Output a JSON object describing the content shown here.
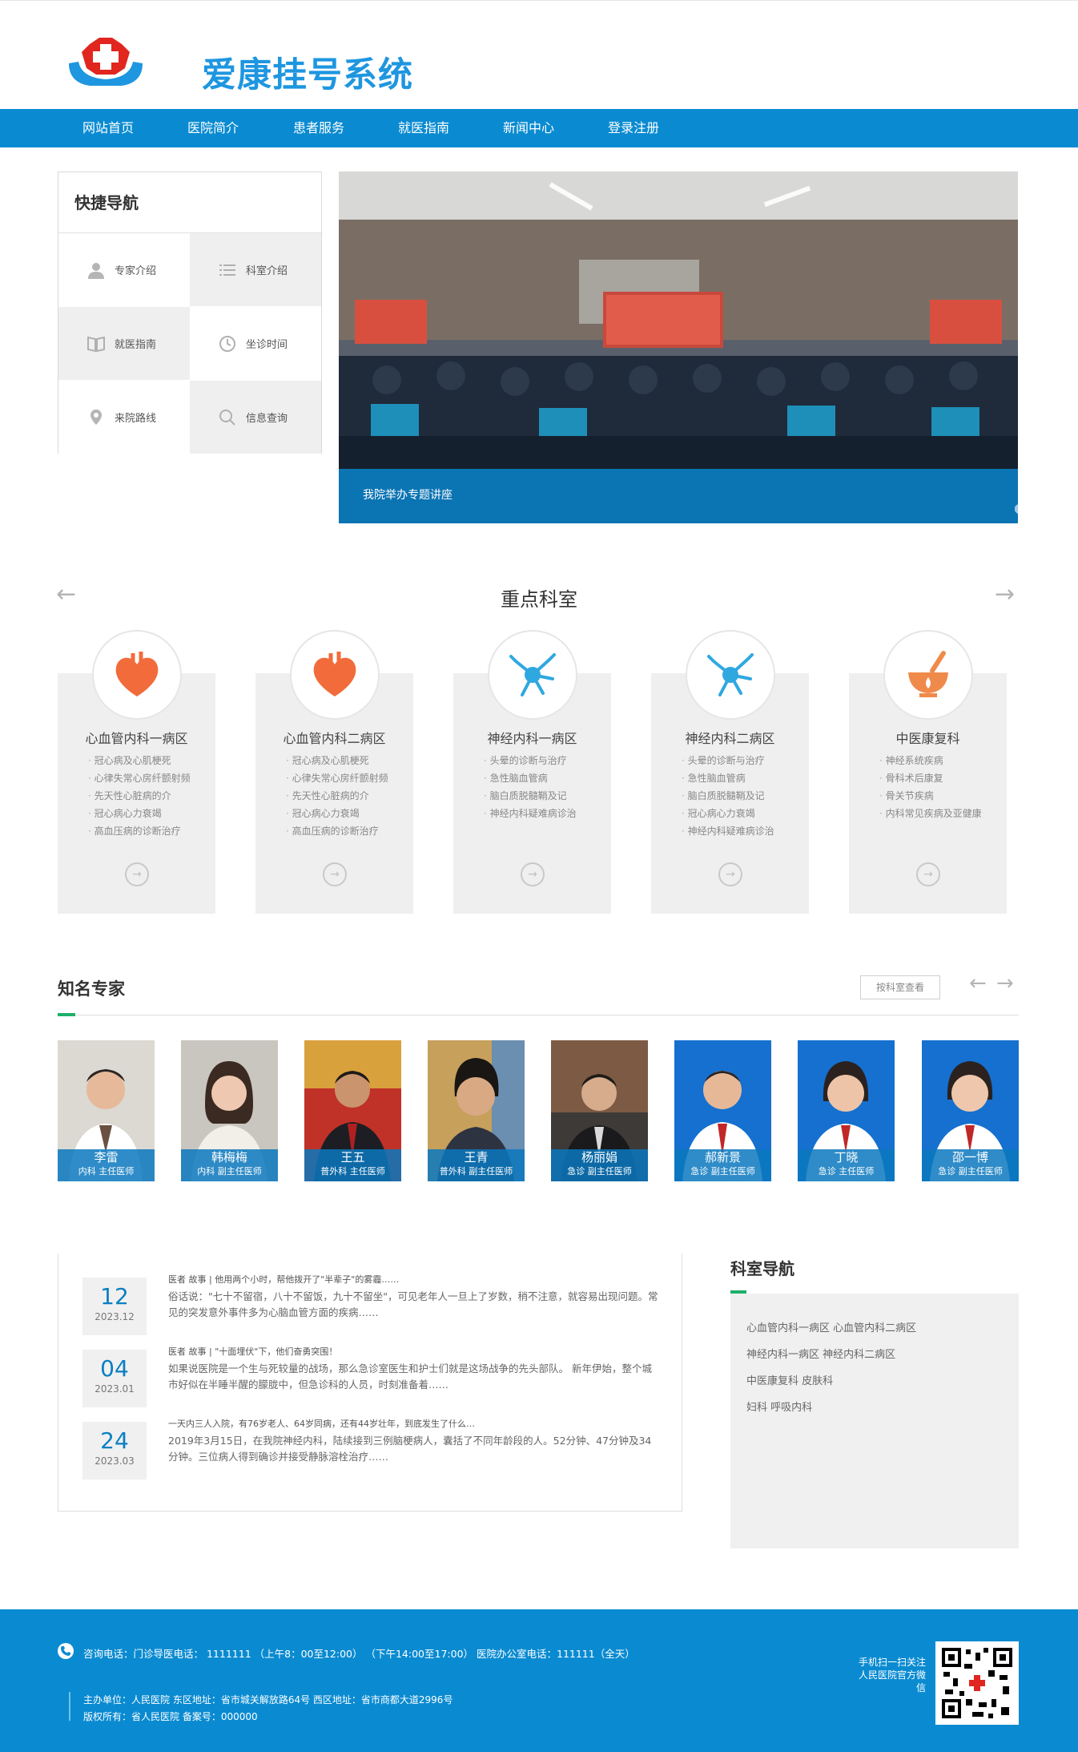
{
  "site": {
    "brand": "爱康挂号系统"
  },
  "nav": [
    "网站首页",
    "医院简介",
    "患者服务",
    "就医指南",
    "新闻中心",
    "登录注册"
  ],
  "quick_nav": {
    "title": "快捷导航",
    "items": [
      "专家介绍",
      "科室介绍",
      "就医指南",
      "坐诊时间",
      "来院路线",
      "信息查询"
    ]
  },
  "banner": {
    "caption": "我院举办专题讲座",
    "dots": 7,
    "active_dot": 5
  },
  "departments": {
    "title": "重点科室",
    "items": [
      {
        "name": "心血管内科一病区",
        "icon": "heart-icon",
        "list": [
          "冠心病及心肌梗死",
          "心律失常心房纤颤射频",
          "先天性心脏病的介",
          "冠心病心力衰竭",
          "高血压病的诊断治疗"
        ]
      },
      {
        "name": "心血管内科二病区",
        "icon": "heart-icon",
        "list": [
          "冠心病及心肌梗死",
          "心律失常心房纤颤射频",
          "先天性心脏病的介",
          "冠心病心力衰竭",
          "高血压病的诊断治疗"
        ]
      },
      {
        "name": "神经内科一病区",
        "icon": "neuron-icon",
        "list": [
          "头晕的诊断与治疗",
          "急性脑血管病",
          "脑白质脱髓鞘及记",
          "神经内科疑难病诊治"
        ]
      },
      {
        "name": "神经内科二病区",
        "icon": "neuron-icon",
        "list": [
          "头晕的诊断与治疗",
          "急性脑血管病",
          "脑白质脱髓鞘及记",
          "冠心病心力衰竭",
          "神经内科疑难病诊治"
        ]
      },
      {
        "name": "中医康复科",
        "icon": "mortar-icon",
        "list": [
          "神经系统疾病",
          "骨科术后康复",
          "骨关节疾病",
          "内科常见疾病及亚健康"
        ]
      }
    ]
  },
  "experts": {
    "title": "知名专家",
    "button": "按科室查看",
    "items": [
      {
        "name": "李雷",
        "role": "内科 主任医师"
      },
      {
        "name": "韩梅梅",
        "role": "内科 副主任医师"
      },
      {
        "name": "王五",
        "role": "普外科 主任医师"
      },
      {
        "name": "王青",
        "role": "普外科 副主任医师"
      },
      {
        "name": "杨丽娟",
        "role": "急诊 副主任医师"
      },
      {
        "name": "郝新景",
        "role": "急诊 副主任医师"
      },
      {
        "name": "丁晓",
        "role": "急诊 主任医师"
      },
      {
        "name": "邵一博",
        "role": "急诊 副主任医师"
      }
    ]
  },
  "news": [
    {
      "day": "12",
      "month": "2023.12",
      "title": "医者 故事 | 他用两个小时，帮他拨开了\"半辈子\"的雾霾……",
      "body": "俗话说：\"七十不留宿，八十不留饭，九十不留坐\"，可见老年人一旦上了岁数，稍不注意，就容易出现问题。常见的突发意外事件多为心脑血管方面的疾病……"
    },
    {
      "day": "04",
      "month": "2023.01",
      "title": "医者 故事 | \"十面埋伏\"下，他们奋勇突围！",
      "body": "如果说医院是一个生与死较量的战场，那么急诊室医生和护士们就是这场战争的先头部队。 新年伊始，整个城市好似在半睡半醒的朦胧中，但急诊科的人员，时刻准备着……"
    },
    {
      "day": "24",
      "month": "2023.03",
      "title": "一天内三人入院，有76岁老人、64岁同病，还有44岁壮年，到底发生了什么…",
      "body": "2019年3月15日，在我院神经内科，陆续接到三例脑梗病人，囊括了不同年龄段的人。52分钟、47分钟及34分钟。三位病人得到确诊并接受静脉溶栓治疗……"
    }
  ],
  "dept_nav": {
    "title": "科室导航",
    "rows": [
      "心血管内科一病区 心血管内科二病区",
      "神经内科一病区 神经内科二病区",
      "中医康复科 皮肤科",
      "妇科 呼吸内科"
    ]
  },
  "footer": {
    "phone": "咨询电话：门诊导医电话： 1111111 （上午8：00至12:00） （下午14:00至17:00）    医院办公室电话：111111（全天）",
    "address": "主办单位：人民医院    东区地址：省市城关解放路64号    西区地址：省市商都大道2996号",
    "copyright": "版权所有：省人民医院    备案号：000000",
    "qr_text": [
      "手机扫一扫关注",
      "人民医院官方微",
      "信"
    ]
  }
}
